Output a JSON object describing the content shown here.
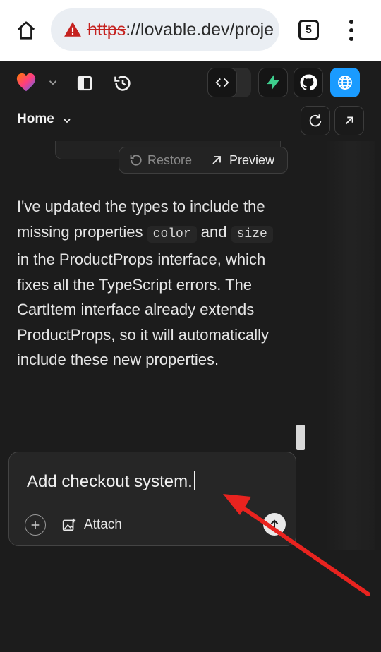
{
  "browser": {
    "url_scheme": "https",
    "url_rest": "://lovable.dev/proje",
    "tab_count": "5"
  },
  "toolbar": {
    "globe_color": "#1a9bff",
    "bolt_color": "#3ecf8e"
  },
  "nav": {
    "home_label": "Home"
  },
  "version": {
    "restore_label": "Restore",
    "preview_label": "Preview"
  },
  "message": {
    "part1": "I've updated the types to include the missing properties",
    "code1": "color",
    "part2": "and",
    "code2": "size",
    "part3": "in the ProductProps interface, which fixes all the TypeScript errors. The CartItem interface already extends ProductProps, so it will automatically include these new properties."
  },
  "composer": {
    "input_value": "Add checkout system.",
    "attach_label": "Attach"
  }
}
